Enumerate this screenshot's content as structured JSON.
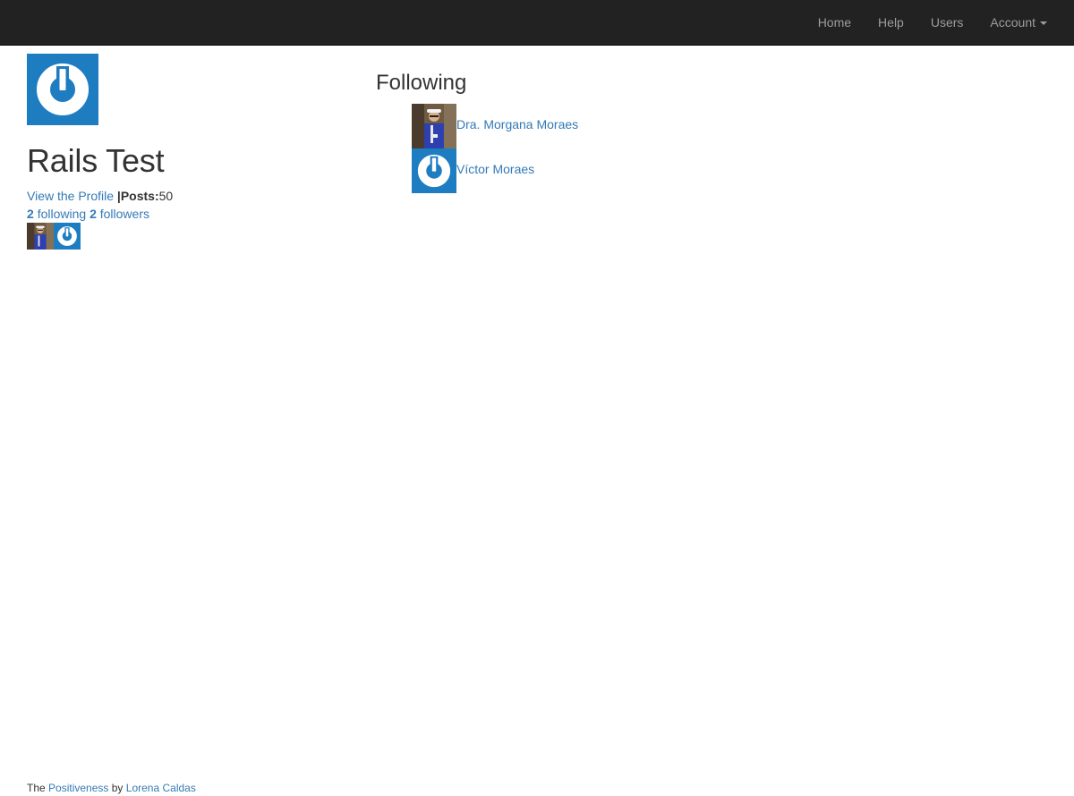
{
  "navbar": {
    "links": [
      {
        "label": "Home"
      },
      {
        "label": "Help"
      },
      {
        "label": "Users"
      },
      {
        "label": "Account"
      }
    ]
  },
  "profile": {
    "name": "Rails Test",
    "view_profile_label": "View the Profile",
    "separator": "|",
    "posts_label": "Posts:",
    "posts_count": "50",
    "following_count": "2",
    "following_label": "following",
    "followers_count": "2",
    "followers_label": "followers",
    "avatar_icon": "gravatar-power-icon"
  },
  "following": {
    "title": "Following",
    "users": [
      {
        "name": "Dra. Morgana Moraes",
        "avatar": "photo-avatar"
      },
      {
        "name": "Víctor Moraes",
        "avatar": "gravatar-power-icon"
      }
    ]
  },
  "footer": {
    "prefix": "The",
    "app_link": "Positiveness",
    "by": "by",
    "author_link": "Lorena Caldas"
  },
  "colors": {
    "navbar_bg": "#222222",
    "nav_text": "#9d9d9d",
    "link": "#337ab7",
    "gravatar_blue": "#1e7dc1"
  }
}
